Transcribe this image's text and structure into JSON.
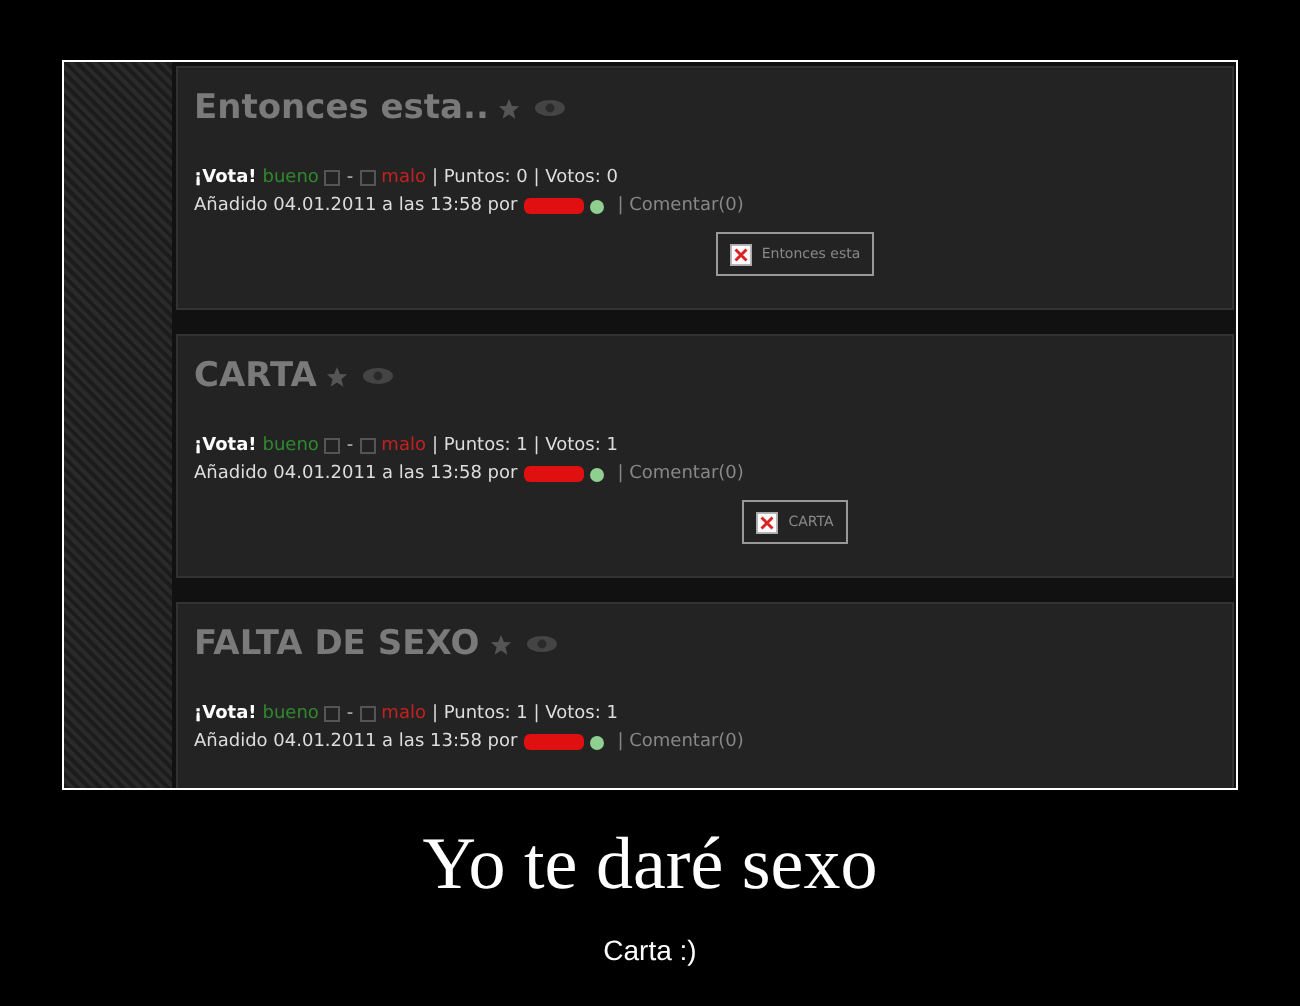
{
  "posts": [
    {
      "title": "Entonces esta..",
      "vote_label": "¡Vota!",
      "good": "bueno",
      "separator": "-",
      "bad": "malo",
      "points": "| Puntos: 0 | Votos: 0",
      "added": "Añadido 04.01.2011 a las 13:58 por",
      "comment": "| Comentar(0)",
      "image_alt": "Entonces esta"
    },
    {
      "title": "CARTA",
      "vote_label": "¡Vota!",
      "good": "bueno",
      "separator": "-",
      "bad": "malo",
      "points": "| Puntos: 1 | Votos: 1",
      "added": "Añadido 04.01.2011 a las 13:58 por",
      "comment": "| Comentar(0)",
      "image_alt": "CARTA"
    },
    {
      "title": "FALTA DE SEXO",
      "vote_label": "¡Vota!",
      "good": "bueno",
      "separator": "-",
      "bad": "malo",
      "points": "| Puntos: 1 | Votos: 1",
      "added": "Añadido 04.01.2011 a las 13:58 por",
      "comment": "| Comentar(0)"
    }
  ],
  "caption": {
    "title": "Yo te daré sexo",
    "subtitle": "Carta :)"
  }
}
